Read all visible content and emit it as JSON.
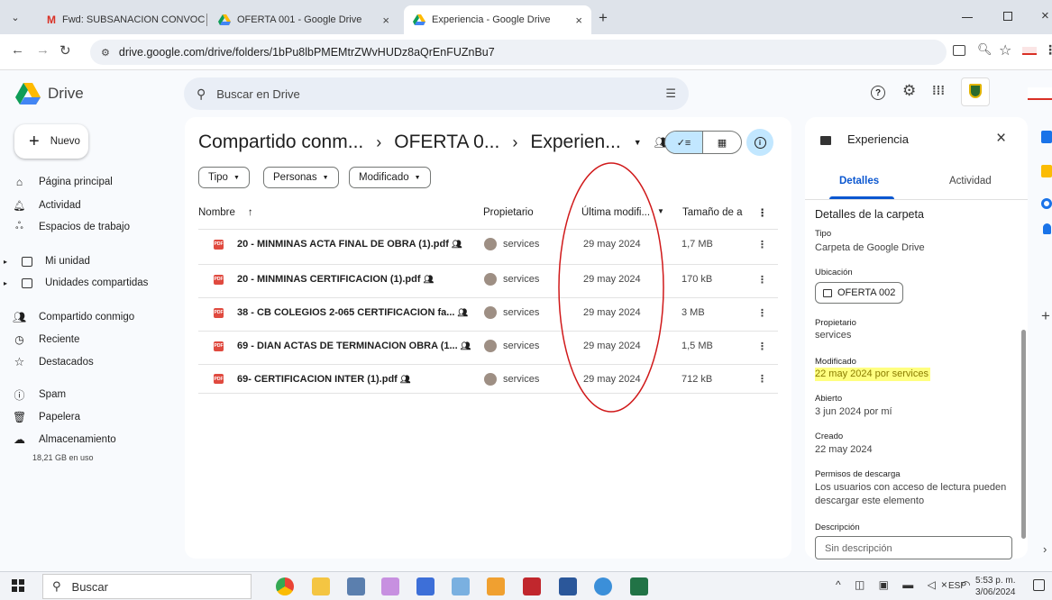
{
  "browser": {
    "tabs": [
      {
        "label": "Fwd: SUBSANACION CONVOCA",
        "icon": "gmail-icon",
        "close": "×"
      },
      {
        "label": "OFERTA 001 - Google Drive",
        "icon": "drive-icon",
        "close": "×"
      },
      {
        "label": "Experiencia - Google Drive",
        "icon": "drive-icon",
        "close": "×"
      }
    ],
    "new_tab": "+",
    "url": "drive.google.com/drive/folders/1bPu8lbPMEMtrZWvHUDz8aQrEnFUZnBu7"
  },
  "drive": {
    "logo_text": "Drive",
    "search_placeholder": "Buscar en Drive",
    "new_button": "Nuevo",
    "nav": [
      {
        "label": "Página principal",
        "icon": "home-icon"
      },
      {
        "label": "Actividad",
        "icon": "bell-icon"
      },
      {
        "label": "Espacios de trabajo",
        "icon": "workspaces-icon"
      },
      {
        "label": "Mi unidad",
        "icon": "my-drive-icon"
      },
      {
        "label": "Unidades compartidas",
        "icon": "shared-drives-icon"
      },
      {
        "label": "Compartido conmigo",
        "icon": "shared-with-me-icon"
      },
      {
        "label": "Reciente",
        "icon": "clock-icon"
      },
      {
        "label": "Destacados",
        "icon": "star-icon"
      },
      {
        "label": "Spam",
        "icon": "spam-icon"
      },
      {
        "label": "Papelera",
        "icon": "trash-icon"
      },
      {
        "label": "Almacenamiento",
        "icon": "cloud-icon"
      }
    ],
    "storage": "18,21 GB en uso",
    "breadcrumb": [
      "Compartido conm...",
      "OFERTA 0...",
      "Experien..."
    ],
    "breadcrumb_sep": "›",
    "filters": [
      "Tipo",
      "Personas",
      "Modificado"
    ],
    "columns": {
      "name": "Nombre",
      "owner": "Propietario",
      "modified": "Última modifi...",
      "size": "Tamaño de a"
    },
    "files": [
      {
        "name": "20 - MINMINAS ACTA FINAL DE OBRA (1).pdf",
        "owner": "services",
        "modified": "29 may 2024",
        "size": "1,7 MB"
      },
      {
        "name": "20 - MINMINAS CERTIFICACION (1).pdf",
        "owner": "services",
        "modified": "29 may 2024",
        "size": "170 kB"
      },
      {
        "name": "38 - CB COLEGIOS 2-065 CERTIFICACION fa...",
        "owner": "services",
        "modified": "29 may 2024",
        "size": "3 MB"
      },
      {
        "name": "69 - DIAN ACTAS DE TERMINACION OBRA (1...",
        "owner": "services",
        "modified": "29 may 2024",
        "size": "1,5 MB"
      },
      {
        "name": "69- CERTIFICACION INTER (1).pdf",
        "owner": "services",
        "modified": "29 may 2024",
        "size": "712 kB"
      }
    ],
    "file_badge": "PDF",
    "panel": {
      "title": "Experiencia",
      "tabs": [
        "Detalles",
        "Actividad"
      ],
      "section": "Detalles de la carpeta",
      "type_label": "Tipo",
      "type_value": "Carpeta de Google Drive",
      "location_label": "Ubicación",
      "location_value": "OFERTA 002",
      "owner_label": "Propietario",
      "owner_value": "services",
      "modified_label": "Modificado",
      "modified_value": "22 may 2024 por services",
      "opened_label": "Abierto",
      "opened_value": "3 jun 2024 por mí",
      "created_label": "Creado",
      "created_value": "22 may 2024",
      "download_label": "Permisos de descarga",
      "download_value": "Los usuarios con acceso de lectura pueden descargar este elemento",
      "description_label": "Descripción",
      "description_placeholder": "Sin descripción"
    }
  },
  "taskbar": {
    "search": "Buscar",
    "lang": "ESP",
    "time": "5:53 p. m.",
    "date": "3/06/2024"
  },
  "colors": {
    "accent": "#0b57d0",
    "highlight": "#ffff80",
    "annotation": "#d0191a",
    "selected": "#c2e7ff"
  }
}
